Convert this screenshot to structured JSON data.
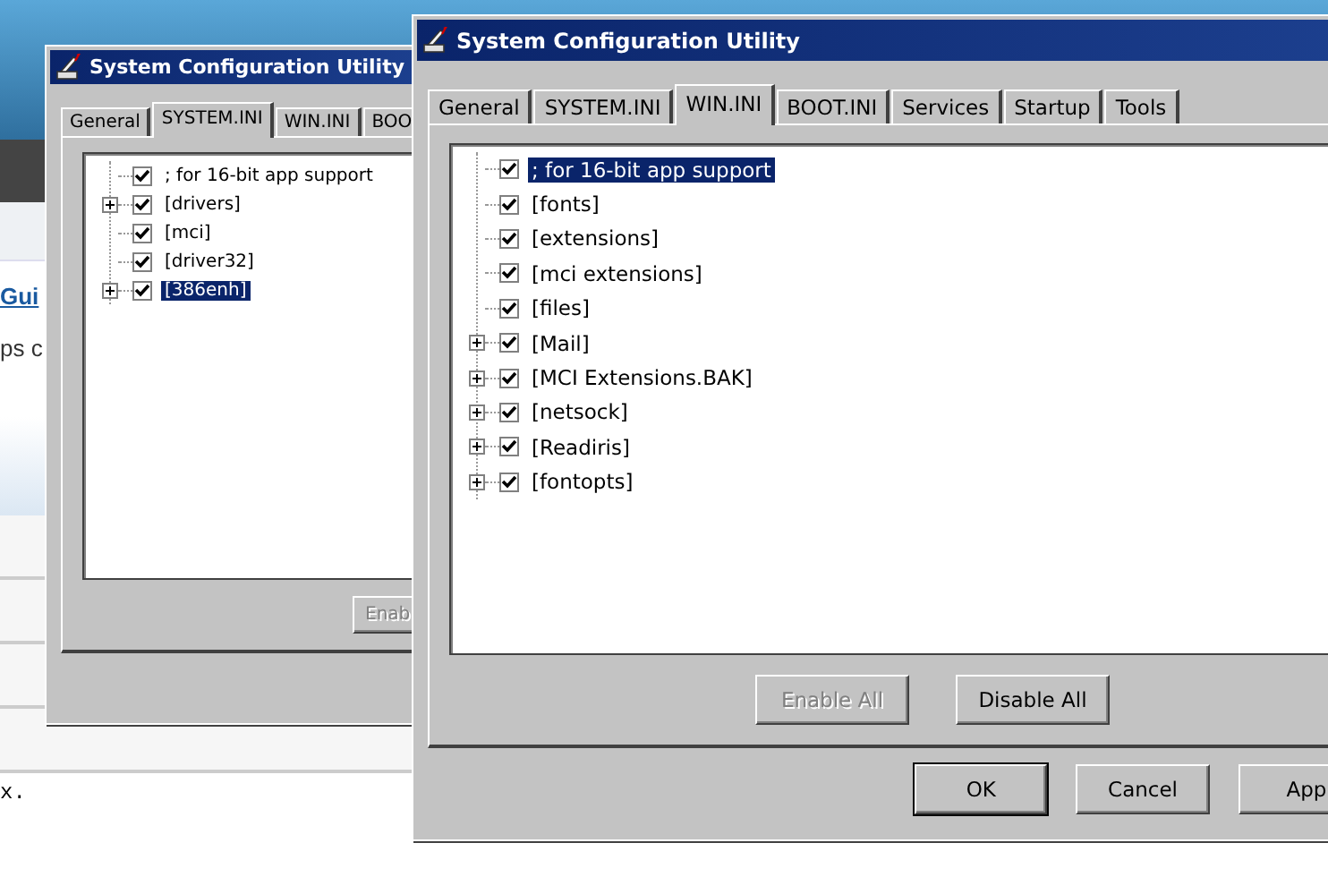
{
  "background_page": {
    "link": "Gui",
    "text": "ps c",
    "code": "x."
  },
  "dialogs": [
    {
      "title": "System Configuration Utility",
      "tabs": [
        {
          "label": "General",
          "selected": false
        },
        {
          "label": "SYSTEM.INI",
          "selected": true
        },
        {
          "label": "WIN.INI",
          "selected": false
        },
        {
          "label": "BOO",
          "selected": false
        }
      ],
      "tree": [
        {
          "label": "; for 16-bit app support",
          "expandable": false,
          "checked": true,
          "selected": false
        },
        {
          "label": "[drivers]",
          "expandable": true,
          "checked": true,
          "selected": false
        },
        {
          "label": "[mci]",
          "expandable": false,
          "checked": true,
          "selected": false
        },
        {
          "label": "[driver32]",
          "expandable": false,
          "checked": true,
          "selected": false
        },
        {
          "label": "[386enh]",
          "expandable": true,
          "checked": true,
          "selected": true
        }
      ],
      "buttons": [
        {
          "label": "Enab",
          "disabled": true
        }
      ]
    },
    {
      "title": "System Configuration Utility",
      "tabs": [
        {
          "label": "General",
          "selected": false
        },
        {
          "label": "SYSTEM.INI",
          "selected": false
        },
        {
          "label": "WIN.INI",
          "selected": true
        },
        {
          "label": "BOOT.INI",
          "selected": false
        },
        {
          "label": "Services",
          "selected": false
        },
        {
          "label": "Startup",
          "selected": false
        },
        {
          "label": "Tools",
          "selected": false
        }
      ],
      "tree": [
        {
          "label": "; for 16-bit app support",
          "expandable": false,
          "checked": true,
          "selected": true
        },
        {
          "label": "[fonts]",
          "expandable": false,
          "checked": true,
          "selected": false
        },
        {
          "label": "[extensions]",
          "expandable": false,
          "checked": true,
          "selected": false
        },
        {
          "label": "[mci extensions]",
          "expandable": false,
          "checked": true,
          "selected": false
        },
        {
          "label": "[files]",
          "expandable": false,
          "checked": true,
          "selected": false
        },
        {
          "label": "[Mail]",
          "expandable": true,
          "checked": true,
          "selected": false
        },
        {
          "label": "[MCI Extensions.BAK]",
          "expandable": true,
          "checked": true,
          "selected": false
        },
        {
          "label": "[netsock]",
          "expandable": true,
          "checked": true,
          "selected": false
        },
        {
          "label": "[Readiris]",
          "expandable": true,
          "checked": true,
          "selected": false
        },
        {
          "label": "[fontopts]",
          "expandable": true,
          "checked": true,
          "selected": false
        }
      ],
      "buttons": [
        {
          "label": "Enable All",
          "disabled": true
        },
        {
          "label": "Disable All",
          "disabled": false
        }
      ],
      "footer_buttons": [
        {
          "label": "OK",
          "disabled": false
        },
        {
          "label": "Cancel",
          "disabled": false
        },
        {
          "label": "App",
          "disabled": false
        }
      ]
    }
  ]
}
